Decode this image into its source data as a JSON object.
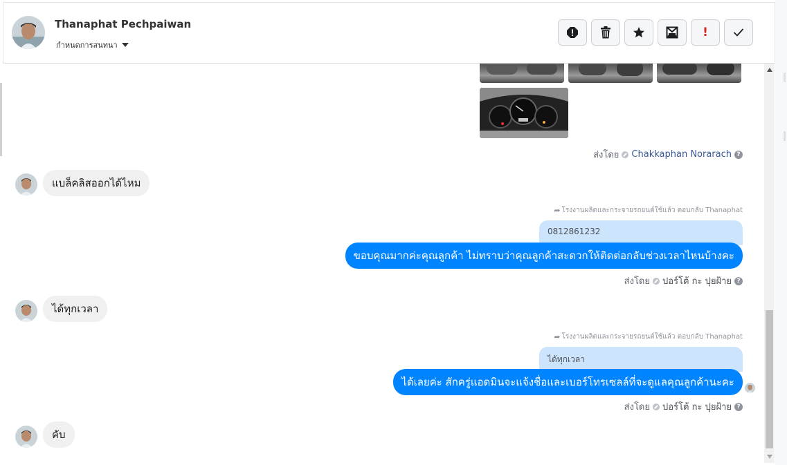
{
  "header": {
    "name": "Thanaphat Pechpaiwan",
    "label_dropdown": "กำหนดการสนทนา",
    "actions": [
      "report-icon",
      "trash-icon",
      "star-icon",
      "archive-icon",
      "important-icon",
      "done-icon"
    ]
  },
  "messages": {
    "sent_by_1": {
      "prefix": "ส่งโดย",
      "agent": "Chakkaphan Norarach"
    },
    "customer_1": "แบล็คลิสออกได้ไหม",
    "reply_1": {
      "reply_to": "โรงงานผลิตและกระจายรถยนต์ใช้แล้ว ตอบกลับ Thanaphat",
      "quote": "0812861232",
      "text": "ขอบคุณมากค่ะคุณลูกค้า ไม่ทราบว่าคุณลูกค้าสะดวกให้ติดต่อกลับช่วงเวลาไหนบ้างคะ",
      "sent_by_prefix": "ส่งโดย",
      "agent": "ปอร์โต้ กะ ปุยฝ้าย"
    },
    "customer_2": "ได้ทุกเวลา",
    "reply_2": {
      "reply_to": "โรงงานผลิตและกระจายรถยนต์ใช้แล้ว ตอบกลับ Thanaphat",
      "quote": "ได้ทุกเวลา",
      "text": "ได้เลยค่ะ สักครู่แอดมินจะแจ้งชื่อและเบอร์โทรเซลล์ที่จะดูแลคุณลูกค้านะคะ",
      "sent_by_prefix": "ส่งโดย",
      "agent": "ปอร์โต้ กะ ปุยฝ้าย"
    },
    "customer_3": "คับ"
  },
  "icons": {
    "help": "?",
    "important": "!"
  },
  "colors": {
    "outgoing_bubble": "#0084ff",
    "incoming_bubble": "#f1f0f0",
    "quote_bubble": "#cde4fd",
    "agent_link": "#365899",
    "important_red": "#e02020"
  }
}
